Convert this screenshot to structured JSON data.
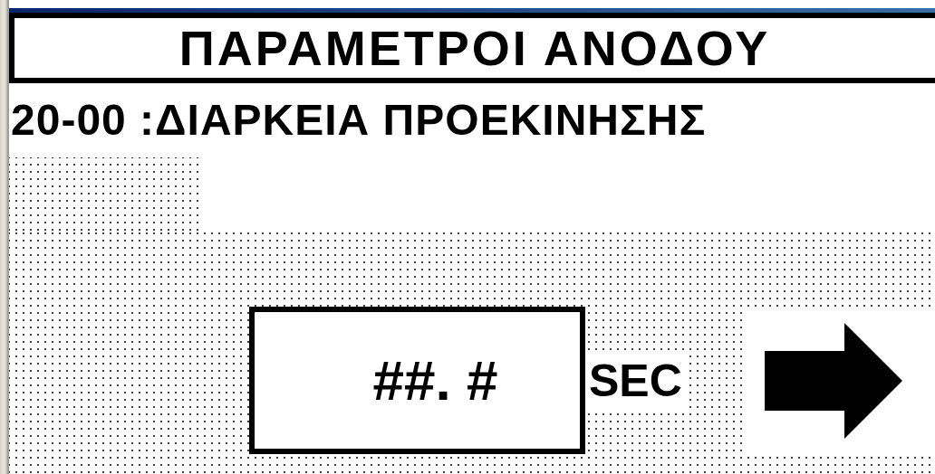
{
  "screen": {
    "title": "ΠΑΡΑΜΕΤΡΟΙ ΑΝΟΔΟΥ",
    "parameter": "20-00 :ΔΙΑΡΚΕΙΑ ΠΡΟΕΚΙΝΗΣΗΣ",
    "value_field": {
      "value": "##. #"
    },
    "unit": "SEC"
  }
}
